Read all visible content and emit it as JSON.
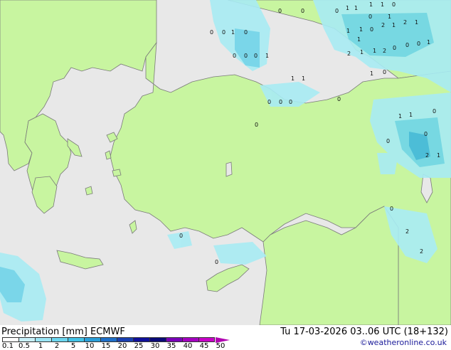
{
  "map": {
    "title": "Precipitation [mm]   ECMWF",
    "datetime": "Tu 17-03-2026 03..06 UTC (18+132)",
    "credit": "©weatheronline.co.uk",
    "colors": {
      "sea": "#e8e8e8",
      "land": "#c8f5a0",
      "coast": "#7a7a7a",
      "precip_light": "#a8ecf4",
      "precip_mid": "#6fd5ea",
      "precip_strong": "#3fb8dd"
    },
    "legend": {
      "labels": [
        "0.1",
        "0.5",
        "1",
        "2",
        "5",
        "10",
        "15",
        "20",
        "25",
        "30",
        "35",
        "40",
        "45",
        "50"
      ],
      "colors": [
        "#ffffff",
        "#c8f0fa",
        "#9be5f5",
        "#6cd6ef",
        "#42c2e6",
        "#2a9ed8",
        "#1f6fc8",
        "#1a3fb0",
        "#10109a",
        "#0a0a78",
        "#7a00b8",
        "#a400c0",
        "#c800c8",
        "#e000d4"
      ]
    },
    "values": [
      {
        "text": "1"
      },
      {
        "text": "1"
      },
      {
        "text": "1"
      },
      {
        "text": "1"
      },
      {
        "text": "0"
      },
      {
        "text": "0"
      },
      {
        "text": "0"
      },
      {
        "text": "0"
      },
      {
        "text": "0"
      },
      {
        "text": "1"
      },
      {
        "text": "0"
      },
      {
        "text": "0"
      },
      {
        "text": "1"
      },
      {
        "text": "0"
      },
      {
        "text": "1"
      },
      {
        "text": "1"
      },
      {
        "text": "0"
      },
      {
        "text": "2"
      },
      {
        "text": "1"
      },
      {
        "text": "2"
      },
      {
        "text": "1"
      },
      {
        "text": "1"
      },
      {
        "text": "2"
      },
      {
        "text": "1"
      },
      {
        "text": "1"
      },
      {
        "text": "2"
      },
      {
        "text": "0"
      },
      {
        "text": "0"
      },
      {
        "text": "0"
      },
      {
        "text": "1"
      },
      {
        "text": "0"
      },
      {
        "text": "0"
      },
      {
        "text": "0"
      },
      {
        "text": "1"
      },
      {
        "text": "1"
      },
      {
        "text": "0"
      },
      {
        "text": "1"
      },
      {
        "text": "1"
      },
      {
        "text": "0"
      },
      {
        "text": "0"
      },
      {
        "text": "0"
      },
      {
        "text": "0"
      },
      {
        "text": "2"
      },
      {
        "text": "1"
      },
      {
        "text": "0"
      },
      {
        "text": "0"
      },
      {
        "text": "0"
      },
      {
        "text": "1"
      },
      {
        "text": "0"
      },
      {
        "text": "1"
      },
      {
        "text": "0"
      },
      {
        "text": "2"
      },
      {
        "text": "0"
      },
      {
        "text": "0"
      },
      {
        "text": "2"
      }
    ]
  }
}
